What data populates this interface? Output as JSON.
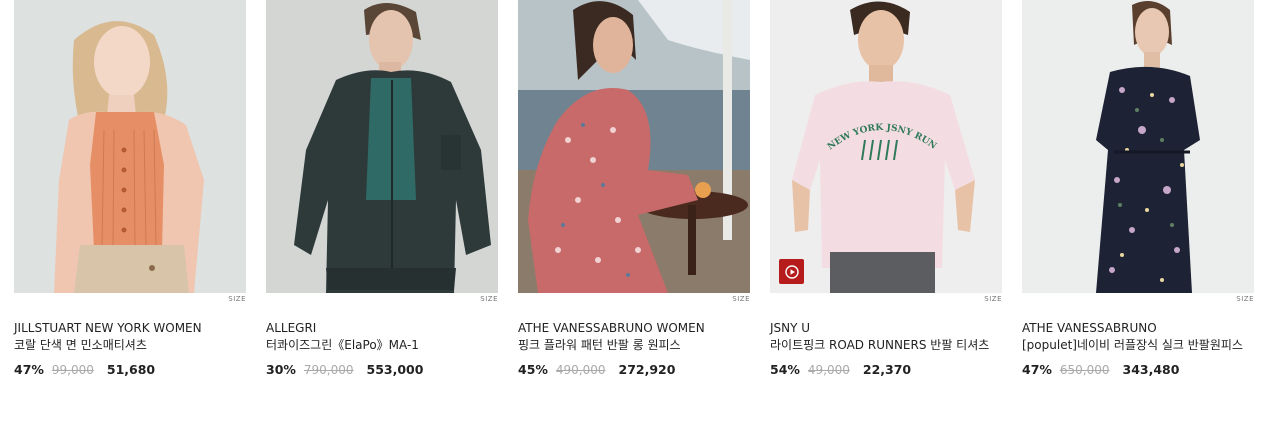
{
  "size_label": "SIZE",
  "products": [
    {
      "brand": "JILLSTUART NEW YORK WOMEN",
      "name": "코랄 단색 면 민소매티셔츠",
      "discount": "47%",
      "original_price": "99,000",
      "sale_price": "51,680",
      "has_video": false
    },
    {
      "brand": "ALLEGRI",
      "name": "터콰이즈그린《ElaPo》MA-1",
      "discount": "30%",
      "original_price": "790,000",
      "sale_price": "553,000",
      "has_video": false
    },
    {
      "brand": "ATHE VANESSABRUNO WOMEN",
      "name": "핑크 플라워 패턴 반팔 롱 원피스",
      "discount": "45%",
      "original_price": "490,000",
      "sale_price": "272,920",
      "has_video": false
    },
    {
      "brand": "JSNY U",
      "name": "라이트핑크 ROAD RUNNERS 반팔 티셔츠",
      "discount": "54%",
      "original_price": "49,000",
      "sale_price": "22,370",
      "has_video": true,
      "print_text": "NEW YORK JSNY RUNNERS"
    },
    {
      "brand": "ATHE VANESSABRUNO",
      "name": "[populet]네이비 러플장식 실크 반팔원피스",
      "discount": "47%",
      "original_price": "650,000",
      "sale_price": "343,480",
      "has_video": false
    }
  ]
}
